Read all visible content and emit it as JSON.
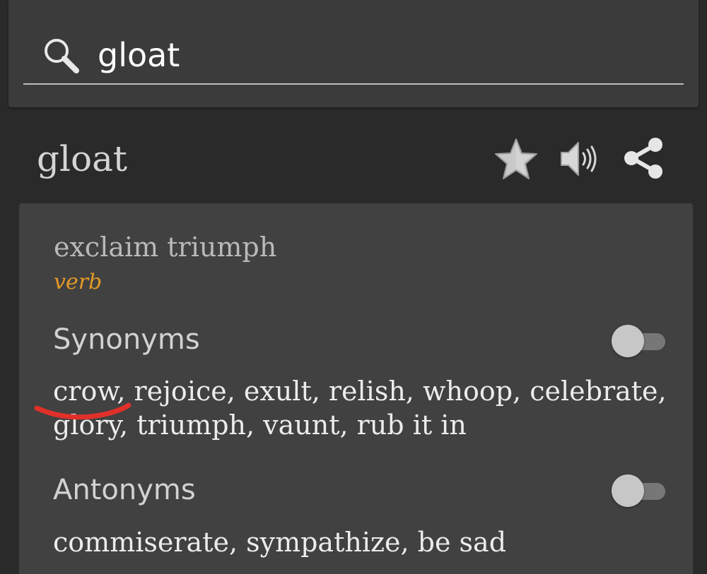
{
  "search": {
    "query": "gloat",
    "icon": "search-icon"
  },
  "entry": {
    "word": "gloat",
    "actions": [
      {
        "name": "favorite",
        "icon": "star-icon"
      },
      {
        "name": "pronounce",
        "icon": "speaker-icon"
      },
      {
        "name": "share",
        "icon": "share-icon"
      }
    ]
  },
  "sense": {
    "definition": "exclaim triumph",
    "part_of_speech": "verb",
    "synonyms": {
      "label": "Synonyms",
      "toggle_on": false,
      "text": "crow, rejoice, exult, relish, whoop, celebrate, glory, triumph, vaunt, rub it in"
    },
    "antonyms": {
      "label": "Antonyms",
      "toggle_on": false,
      "text": "commiserate, sympathize, be sad"
    }
  },
  "colors": {
    "background": "#2a2a2a",
    "search_bar": "#3b3b3b",
    "card": "#414141",
    "part_of_speech": "#e39a25",
    "annotation_mark": "#e0302a"
  }
}
